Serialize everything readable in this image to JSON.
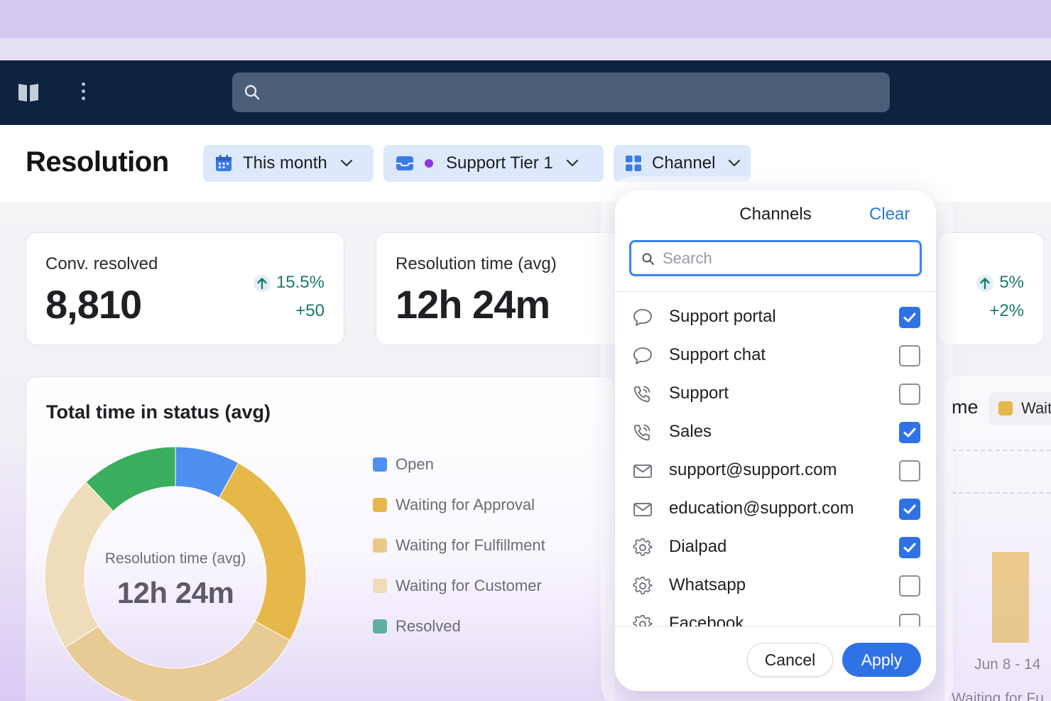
{
  "page": {
    "title": "Resolution",
    "filters": [
      {
        "label": "This month",
        "icon": "calendar-icon"
      },
      {
        "label": "Support Tier 1",
        "icon": "inbox-icon",
        "dot_color": "#8a3ae0"
      },
      {
        "label": "Channel",
        "icon": "grid-icon"
      }
    ]
  },
  "metrics": [
    {
      "label": "Conv. resolved",
      "value": "8,810",
      "delta_pct": "15.5%",
      "delta_abs": "+50"
    },
    {
      "label": "Resolution time (avg)",
      "value": "12h 24m"
    },
    {
      "delta_pct": "5%",
      "delta_abs": "+2%"
    }
  ],
  "chart": {
    "title": "Total time in status (avg)",
    "center_label": "Resolution time (avg)",
    "center_value": "12h 24m",
    "legend": [
      {
        "name": "Open",
        "color": "#4e8ff0"
      },
      {
        "name": "Waiting for Approval",
        "color": "#e6b84a"
      },
      {
        "name": "Waiting for Fulfillment",
        "color": "#e9c98a"
      },
      {
        "name": "Waiting for Customer",
        "color": "#efdcbb"
      },
      {
        "name": "Resolved",
        "color": "#5fb0a3"
      }
    ]
  },
  "chart_data": {
    "type": "pie",
    "title": "Total time in status (avg)",
    "categories": [
      "Open",
      "Waiting for Approval",
      "Waiting for Fulfillment",
      "Waiting for Customer",
      "Resolved"
    ],
    "values": [
      8,
      25,
      33,
      22,
      12
    ],
    "colors": [
      "#4e8ff0",
      "#e6b84a",
      "#e8cb94",
      "#eedcbb",
      "#3aae5c"
    ],
    "center_label": "Resolution time (avg)",
    "center_value": "12h 24m",
    "legend_position": "right"
  },
  "right_partial": {
    "title_fragment": "me",
    "legend_fragment": "Wait",
    "date_label": "Jun 8 - 14",
    "footer_fragment": "Waiting for Fu"
  },
  "panel": {
    "title": "Channels",
    "clear_label": "Clear",
    "search_placeholder": "Search",
    "items": [
      {
        "label": "Support portal",
        "icon": "chat-bubble-icon",
        "checked": true
      },
      {
        "label": "Support chat",
        "icon": "chat-bubble-icon",
        "checked": false
      },
      {
        "label": "Support",
        "icon": "phone-icon",
        "checked": false
      },
      {
        "label": "Sales",
        "icon": "phone-icon",
        "checked": true
      },
      {
        "label": "support@support.com",
        "icon": "mail-icon",
        "checked": false
      },
      {
        "label": "education@support.com",
        "icon": "mail-icon",
        "checked": true
      },
      {
        "label": "Dialpad",
        "icon": "gear-icon",
        "checked": true
      },
      {
        "label": "Whatsapp",
        "icon": "gear-icon",
        "checked": false
      },
      {
        "label": "Facebook",
        "icon": "gear-icon",
        "checked": false
      }
    ],
    "cancel_label": "Cancel",
    "apply_label": "Apply"
  },
  "colors": {
    "accent": "#2f72e6",
    "navbar": "#0d2340",
    "delta_positive": "#1a7a6d"
  }
}
